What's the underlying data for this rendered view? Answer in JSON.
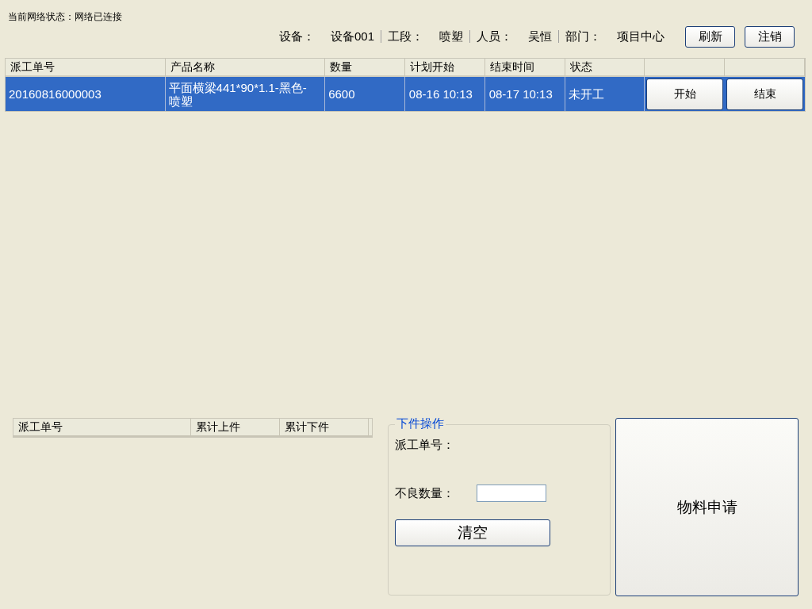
{
  "network_status": "当前网络状态：网络已连接",
  "info": [
    {
      "label": "设备：",
      "value": "设备001"
    },
    {
      "label": "工段：",
      "value": "喷塑"
    },
    {
      "label": "人员：",
      "value": "吴恒"
    },
    {
      "label": "部门：",
      "value": "项目中心"
    }
  ],
  "top_buttons": [
    "刷新",
    "注销"
  ],
  "orders_table": {
    "columns": [
      "派工单号",
      "产品名称",
      "数量",
      "计划开始",
      "结束时间",
      "状态"
    ],
    "rows": [
      {
        "selected": true,
        "cells": [
          "20160816000003",
          "平面横梁441*90*1.1-黑色-喷塑",
          "6600",
          "08-16 10:13",
          "08-17 10:13",
          "未开工"
        ],
        "actions": [
          "开始",
          "结束"
        ]
      }
    ]
  },
  "summary_table": {
    "columns": [
      "派工单号",
      "累计上件",
      "累计下件"
    ]
  },
  "unload_group": {
    "title": "下件操作",
    "order_label": "派工单号：",
    "defect_label": "不良数量：",
    "clear_button": "清空"
  },
  "material_button": "物料申请"
}
